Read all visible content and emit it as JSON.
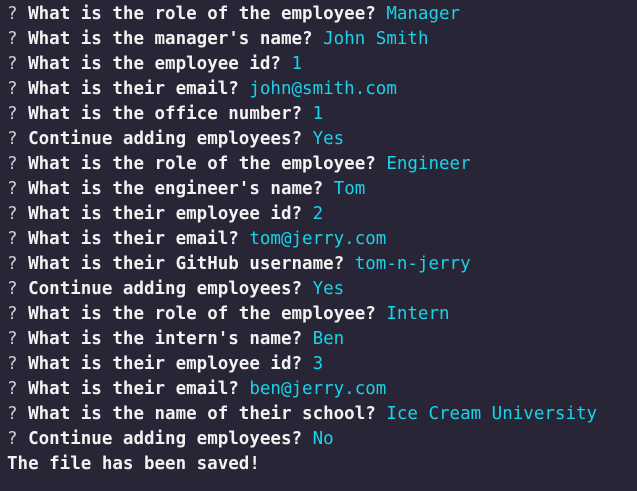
{
  "terminal": {
    "prompt_symbol": "?",
    "lines": [
      {
        "question": "What is the role of the employee?",
        "answer": "Manager"
      },
      {
        "question": "What is the manager's name?",
        "answer": "John Smith"
      },
      {
        "question": "What is the employee id?",
        "answer": "1"
      },
      {
        "question": "What is their email?",
        "answer": "john@smith.com"
      },
      {
        "question": "What is the office number?",
        "answer": "1"
      },
      {
        "question": "Continue adding employees?",
        "answer": "Yes"
      },
      {
        "question": "What is the role of the employee?",
        "answer": "Engineer"
      },
      {
        "question": "What is the engineer's name?",
        "answer": "Tom"
      },
      {
        "question": "What is their employee id?",
        "answer": "2"
      },
      {
        "question": "What is their email?",
        "answer": "tom@jerry.com"
      },
      {
        "question": "What is their GitHub username?",
        "answer": "tom-n-jerry"
      },
      {
        "question": "Continue adding employees?",
        "answer": "Yes"
      },
      {
        "question": "What is the role of the employee?",
        "answer": "Intern"
      },
      {
        "question": "What is the intern's name?",
        "answer": "Ben"
      },
      {
        "question": "What is their employee id?",
        "answer": "3"
      },
      {
        "question": "What is their email?",
        "answer": "ben@jerry.com"
      },
      {
        "question": "What is the name of their school?",
        "answer": "Ice Cream University"
      },
      {
        "question": "Continue adding employees?",
        "answer": "No"
      }
    ],
    "final_message": "The file has been saved!"
  },
  "colors": {
    "background": "#282636",
    "question_text": "#f2f2f2",
    "answer_text": "#19d3e8"
  }
}
